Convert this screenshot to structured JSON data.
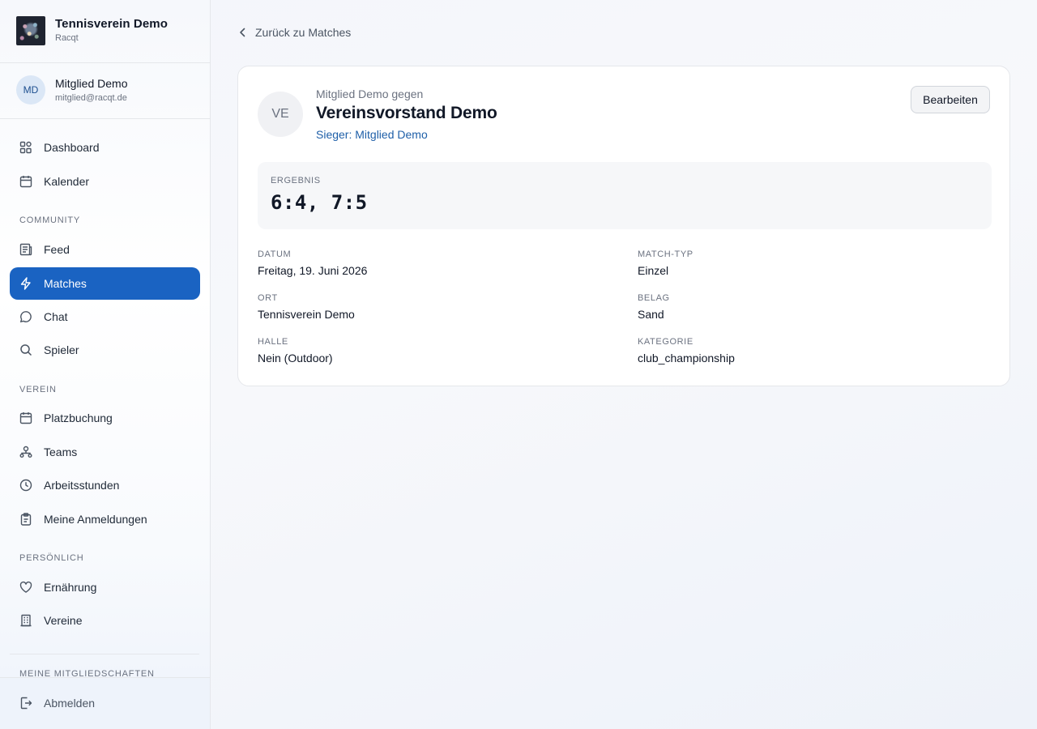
{
  "brand": {
    "title": "Tennisverein Demo",
    "subtitle": "Racqt"
  },
  "user": {
    "initials": "MD",
    "name": "Mitglied Demo",
    "email": "mitglied@racqt.de"
  },
  "nav": {
    "main": [
      {
        "label": "Dashboard",
        "icon": "grid-icon"
      },
      {
        "label": "Kalender",
        "icon": "calendar-icon"
      }
    ],
    "community_label": "COMMUNITY",
    "community": [
      {
        "label": "Feed",
        "icon": "newspaper-icon"
      },
      {
        "label": "Matches",
        "icon": "lightning-icon",
        "active": true
      },
      {
        "label": "Chat",
        "icon": "chat-icon"
      },
      {
        "label": "Spieler",
        "icon": "search-icon"
      }
    ],
    "verein_label": "VEREIN",
    "verein": [
      {
        "label": "Platzbuchung",
        "icon": "calendar-icon"
      },
      {
        "label": "Teams",
        "icon": "team-icon"
      },
      {
        "label": "Arbeitsstunden",
        "icon": "clock-icon"
      },
      {
        "label": "Meine Anmeldungen",
        "icon": "clipboard-icon"
      }
    ],
    "persoenlich_label": "PERSÖNLICH",
    "persoenlich": [
      {
        "label": "Ernährung",
        "icon": "heart-icon"
      },
      {
        "label": "Vereine",
        "icon": "building-icon"
      }
    ],
    "memberships_label": "MEINE MITGLIEDSCHAFTEN",
    "logout": "Abmelden"
  },
  "back_link": "Zurück zu Matches",
  "match": {
    "opponent_initials": "VE",
    "vs_label": "Mitglied Demo gegen",
    "opponent_name": "Vereinsvorstand Demo",
    "winner": "Sieger: Mitglied Demo",
    "edit_label": "Bearbeiten",
    "result_label": "ERGEBNIS",
    "result_value": "6:4, 7:5",
    "details": {
      "datum_label": "DATUM",
      "datum": "Freitag, 19. Juni 2026",
      "match_typ_label": "MATCH-TYP",
      "match_typ": "Einzel",
      "ort_label": "ORT",
      "ort": "Tennisverein Demo",
      "belag_label": "BELAG",
      "belag": "Sand",
      "halle_label": "HALLE",
      "halle": "Nein (Outdoor)",
      "kategorie_label": "KATEGORIE",
      "kategorie": "club_championship"
    }
  },
  "colors": {
    "accent": "#1a63c2",
    "winner": "#1e5fa8"
  }
}
